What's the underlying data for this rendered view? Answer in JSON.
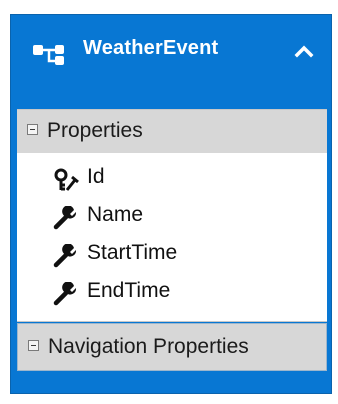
{
  "entity": {
    "title": "WeatherEvent",
    "icon": "entity-icon",
    "collapse_icon": "chevron-up-icon",
    "accent_color": "#0877d3"
  },
  "sections": {
    "properties_label": "Properties",
    "navigation_label": "Navigation Properties"
  },
  "properties": [
    {
      "name": "Id",
      "icon": "key-wrench-icon"
    },
    {
      "name": "Name",
      "icon": "wrench-icon"
    },
    {
      "name": "StartTime",
      "icon": "wrench-icon"
    },
    {
      "name": "EndTime",
      "icon": "wrench-icon"
    }
  ]
}
